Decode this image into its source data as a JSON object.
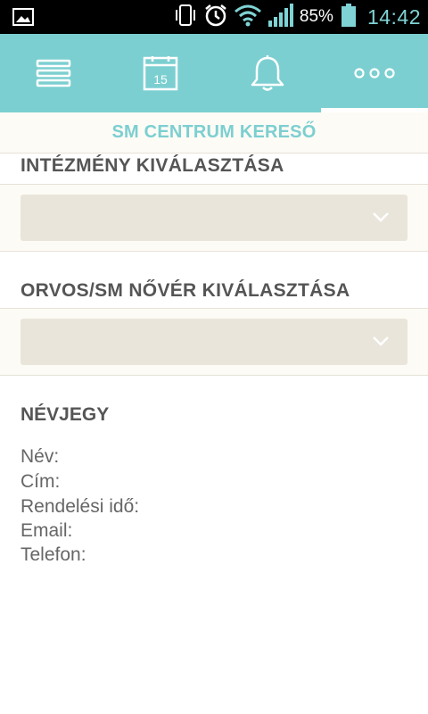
{
  "status_bar": {
    "battery_percent": "85%",
    "time": "14:42",
    "icons": [
      "gallery-icon",
      "vibrate-icon",
      "alarm-icon",
      "wifi-icon",
      "signal-icon",
      "battery-icon"
    ]
  },
  "toolbar": {
    "items": [
      {
        "icon": "menu-list-icon"
      },
      {
        "icon": "calendar-icon",
        "label": "15"
      },
      {
        "icon": "bell-icon"
      },
      {
        "icon": "more-icon"
      }
    ],
    "active_index": 3,
    "color": "#7ccfd1"
  },
  "page": {
    "title": "SM CENTRUM KERESŐ"
  },
  "institution": {
    "label": "INTÉZMÉNY KIVÁLASZTÁSA",
    "selected": ""
  },
  "doctor": {
    "label": "ORVOS/SM NŐVÉR KIVÁLASZTÁSA",
    "selected": ""
  },
  "contact_card": {
    "title": "NÉVJEGY",
    "name_label": "Név:",
    "address_label": "Cím:",
    "hours_label": "Rendelési idő:",
    "email_label": "Email:",
    "phone_label": "Telefon:"
  }
}
